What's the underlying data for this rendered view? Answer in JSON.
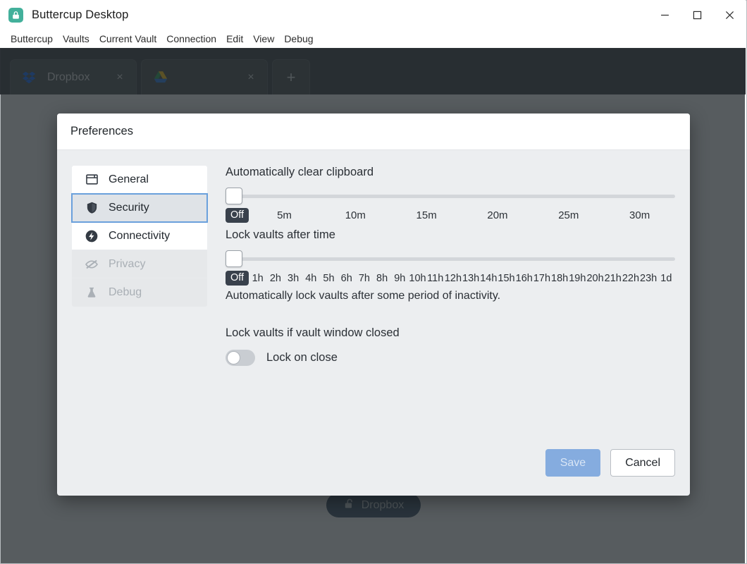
{
  "window": {
    "title": "Buttercup Desktop",
    "logo_icon": "buttercup-lock-logo",
    "controls": {
      "minimize": "minimize-icon",
      "maximize": "maximize-icon",
      "close": "close-icon"
    }
  },
  "menubar": {
    "items": [
      {
        "label": "Buttercup"
      },
      {
        "label": "Vaults"
      },
      {
        "label": "Current Vault"
      },
      {
        "label": "Connection"
      },
      {
        "label": "Edit"
      },
      {
        "label": "View"
      },
      {
        "label": "Debug"
      }
    ]
  },
  "tabs": {
    "items": [
      {
        "label": "Dropbox",
        "icon": "dropbox-icon",
        "close_label": "×",
        "active": true
      },
      {
        "label": "",
        "icon": "google-drive-icon",
        "close_label": "×",
        "active": false
      }
    ],
    "add_label": "+"
  },
  "vault": {
    "unlock_button_label": "Dropbox",
    "unlock_icon": "unlock-icon"
  },
  "dialog": {
    "title": "Preferences",
    "sidebar": {
      "items": [
        {
          "label": "General",
          "icon": "window-icon",
          "state": "normal"
        },
        {
          "label": "Security",
          "icon": "shield-icon",
          "state": "selected"
        },
        {
          "label": "Connectivity",
          "icon": "bolt-icon",
          "state": "normal"
        },
        {
          "label": "Privacy",
          "icon": "eye-off-icon",
          "state": "disabled"
        },
        {
          "label": "Debug",
          "icon": "flask-icon",
          "state": "disabled"
        }
      ]
    },
    "settings": {
      "clipboard": {
        "title": "Automatically clear clipboard",
        "value": "Off",
        "ticks": [
          "Off",
          "5m",
          "10m",
          "15m",
          "20m",
          "25m",
          "30m"
        ]
      },
      "lock_time": {
        "title": "Lock vaults after time",
        "value": "Off",
        "ticks": [
          "Off",
          "1h",
          "2h",
          "3h",
          "4h",
          "5h",
          "6h",
          "7h",
          "8h",
          "9h",
          "10h",
          "11h",
          "12h",
          "13h",
          "14h",
          "15h",
          "16h",
          "17h",
          "18h",
          "19h",
          "20h",
          "21h",
          "22h",
          "23h",
          "1d"
        ],
        "helper": "Automatically lock vaults after some period of inactivity."
      },
      "lock_on_close": {
        "title": "Lock vaults if vault window closed",
        "toggle_label": "Lock on close",
        "enabled": false
      }
    },
    "footer": {
      "save_label": "Save",
      "cancel_label": "Cancel"
    }
  },
  "colors": {
    "accent": "#85acdf",
    "brand": "#43b09b",
    "overlay": "#2d3136",
    "badge": "#39414c",
    "focus_ring": "#6aa0dc"
  }
}
